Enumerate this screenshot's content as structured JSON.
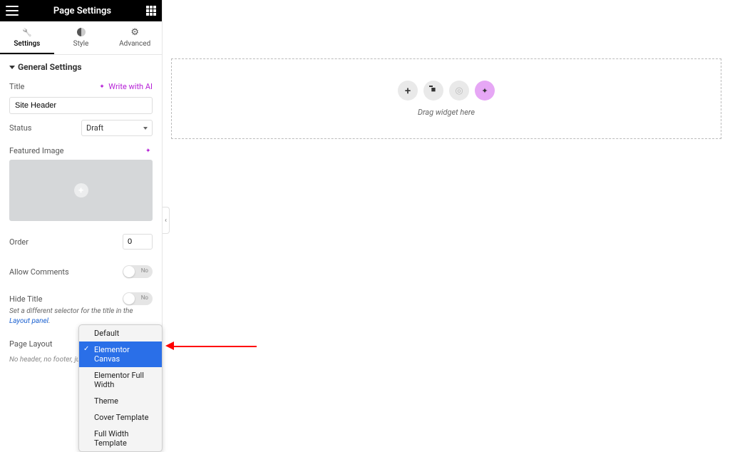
{
  "header": {
    "title": "Page Settings"
  },
  "tabs": {
    "settings": "Settings",
    "style": "Style",
    "advanced": "Advanced"
  },
  "section_title": "General Settings",
  "title_ctrl": {
    "label": "Title",
    "ai": "Write with AI",
    "value": "Site Header"
  },
  "status_ctrl": {
    "label": "Status",
    "value": "Draft"
  },
  "featured_image": {
    "label": "Featured Image"
  },
  "order_ctrl": {
    "label": "Order",
    "value": "0"
  },
  "comments_ctrl": {
    "label": "Allow Comments",
    "state": "No"
  },
  "hide_title_ctrl": {
    "label": "Hide Title",
    "state": "No"
  },
  "hide_title_hint": {
    "pre": "Set a different selector for the title in the ",
    "link": "Layout panel",
    "post": "."
  },
  "layout_ctrl": {
    "label": "Page Layout",
    "desc": "No header, no footer, ju"
  },
  "layout_options": {
    "o0": "Default",
    "o1": "Elementor Canvas",
    "o2": "Elementor Full Width",
    "o3": "Theme",
    "o4": "Cover Template",
    "o5": "Full Width Template"
  },
  "canvas": {
    "drag_text": "Drag widget here"
  },
  "collapse_glyph": "‹"
}
